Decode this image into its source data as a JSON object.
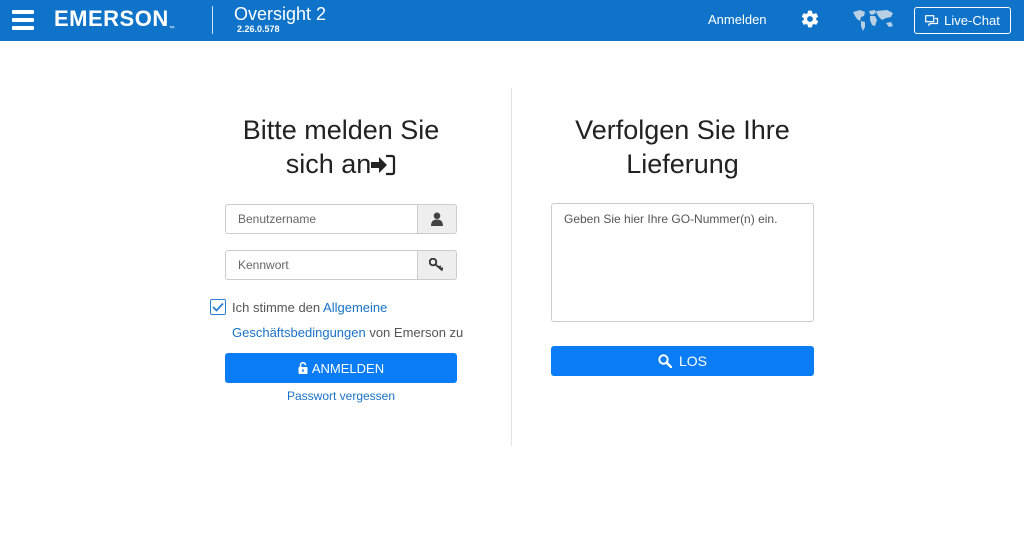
{
  "header": {
    "brand": "EMERSON",
    "brand_tm": "™",
    "app_title": "Oversight 2",
    "app_version": "2.26.0.578",
    "login_link": "Anmelden",
    "live_chat": "Live-Chat",
    "icons": {
      "menu": "hamburger-menu-icon",
      "settings": "gear-icon",
      "region": "world-map-icon",
      "chat": "chat-bubble-icon"
    },
    "bar_color": "#0f73c9"
  },
  "login": {
    "title_line1": "Bitte melden Sie",
    "title_line2": "sich an",
    "username_placeholder": "Benutzername",
    "password_placeholder": "Kennwort",
    "terms_checked": true,
    "terms_text1": "Ich stimme den ",
    "terms_link1": "Allgemeine",
    "terms_link2": "Geschäftsbedingungen",
    "terms_text2": " von Emerson zu",
    "submit_label": "ANMELDEN",
    "forgot_password": "Passwort vergessen"
  },
  "tracking": {
    "title_line1": "Verfolgen Sie Ihre",
    "title_line2": "Lieferung",
    "placeholder": "Geben Sie hier Ihre GO-Nummer(n) ein.",
    "submit_label": "LOS"
  },
  "colors": {
    "primary_button": "#0a7cf5",
    "link": "#1a73c9"
  }
}
